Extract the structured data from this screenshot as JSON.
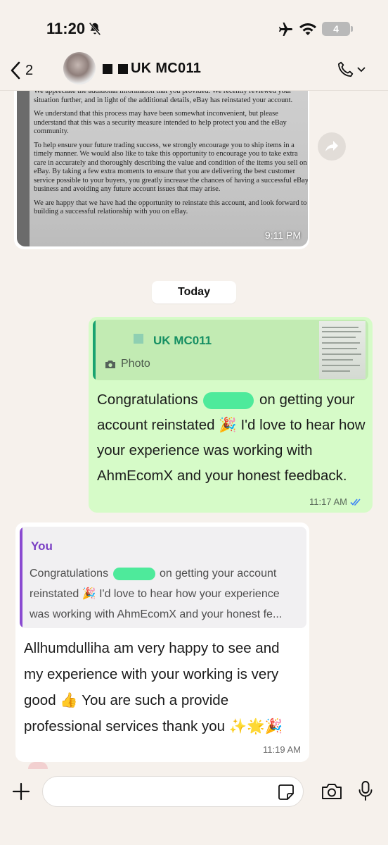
{
  "status": {
    "time": "11:20",
    "battery": "4"
  },
  "header": {
    "back_count": "2",
    "contact_name": "UK MC011"
  },
  "photo_message": {
    "paragraphs": [
      "We appreciate the additional information that you provided. We recently reviewed your situation further, and in light of the additional details, eBay has reinstated your account.",
      "We understand that this process may have been somewhat inconvenient, but please understand that this was a security measure intended to help protect you and the eBay community.",
      "To help ensure your future trading success, we strongly encourage you to ship items in a timely manner. We would also like to take this opportunity to encourage you to take extra care in accurately and thoroughly describing the value and condition of the items you sell on eBay. By taking a few extra moments to ensure that you are delivering the best customer service possible to your buyers, you greatly increase the chances of having a successful eBay business and avoiding any future account issues that may arise.",
      "We are happy that we have had the opportunity to reinstate this account, and look forward to building a successful relationship with you on eBay."
    ],
    "time": "9:11 PM"
  },
  "date_separator": "Today",
  "outgoing": {
    "quote_name": "UK MC011",
    "quote_type": "Photo",
    "text_before": "Congratulations",
    "text_after": "on getting your account reinstated 🎉 I'd love to hear how your experience was working with AhmEcomX and your honest feedback.",
    "time": "11:17 AM"
  },
  "incoming": {
    "quote_name": "You",
    "quote_before": "Congratulations",
    "quote_after": "on getting your account reinstated 🎉 I'd love to hear how your experience was working with AhmEcomX and your honest fe...",
    "text": "Allhumdulliha am very happy to see and my experience with your working is very good 👍 You are such a provide professional services thank you ✨🌟🎉",
    "time": "11:19 AM"
  },
  "input": {
    "placeholder": ""
  },
  "colors": {
    "outgoing_bubble": "#d6fbc8",
    "quote_green": "#19a370",
    "quote_purple": "#8a4ad1",
    "read_ticks": "#3b82f6",
    "background": "#f6f1ec"
  }
}
